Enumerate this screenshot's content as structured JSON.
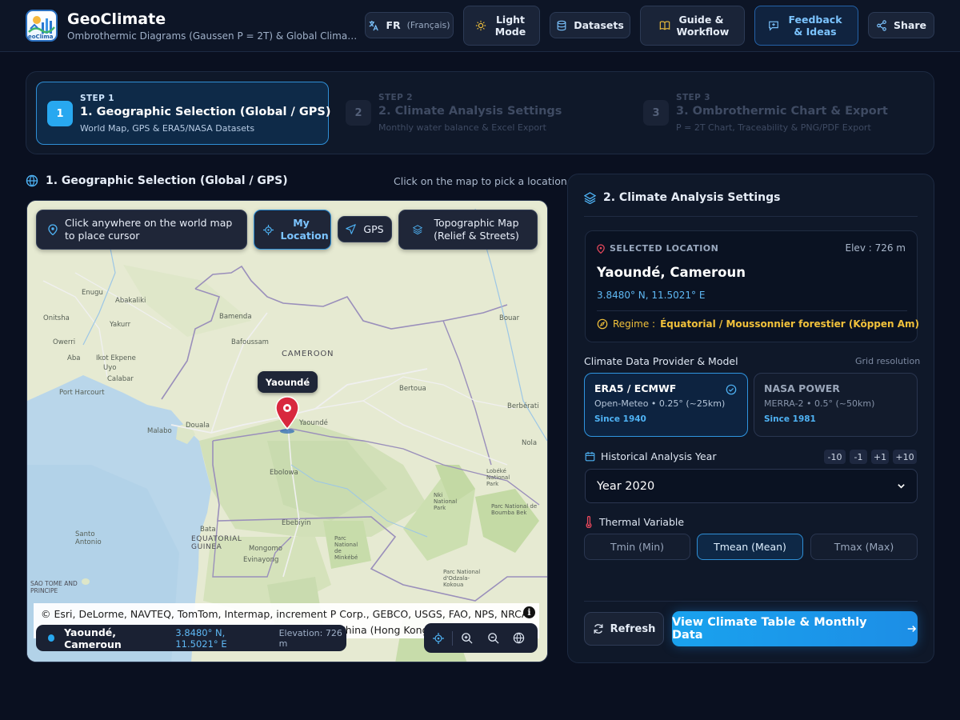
{
  "app": {
    "title": "GeoClimate",
    "subtitle": "Ombrothermic Diagrams (Gaussen P = 2T) & Global Climate Da...",
    "logo_text": "eoClima"
  },
  "header": {
    "lang_code": "FR",
    "lang_name": "(Français)",
    "theme_label": "Light Mode",
    "datasets_label": "Datasets",
    "guide_label": "Guide & Workflow",
    "feedback_label": "Feedback & Ideas",
    "share_label": "Share"
  },
  "steps": [
    {
      "kicker": "STEP 1",
      "number": "1",
      "title": "1. Geographic Selection (Global / GPS)",
      "desc": "World Map, GPS & ERA5/NASA Datasets",
      "active": true
    },
    {
      "kicker": "STEP 2",
      "number": "2",
      "title": "2. Climate Analysis Settings",
      "desc": "Monthly water balance & Excel Export",
      "active": false
    },
    {
      "kicker": "STEP 3",
      "number": "3",
      "title": "3. Ombrothermic Chart & Export",
      "desc": "P = 2T Chart, Traceability & PNG/PDF Export",
      "active": false
    }
  ],
  "geo": {
    "section_title": "1. Geographic Selection (Global / GPS)",
    "hint": "Click on the map to pick a location",
    "click_hint": "Click anywhere on the world map to place cursor",
    "my_location": "My Location",
    "gps": "GPS",
    "map_style": "Topographic Map (Relief & Streets)",
    "pin_label": "Yaoundé",
    "attribution_line1": "© Esri, DeLorme, NAVTEQ, TomTom, Intermap, increment P Corp., GEBCO, USGS, FAO, NPS, NRCAN,",
    "attribution_line2": "China (Hong Kong",
    "place_labels": [
      "Enugu",
      "Abakaliki",
      "Onitsha",
      "Yakurr",
      "Owerri",
      "Aba",
      "Ikot Ekpene",
      "Uyo",
      "Calabar",
      "Port Harcourt",
      "Bamenda",
      "Bafoussam",
      "CAMEROON",
      "Douala",
      "Malabo",
      "Yaoundé",
      "Ebolowa",
      "Ebebiyin",
      "Bata",
      "Mongomo",
      "Evinayong",
      "EQUATORIAL GUINEA",
      "Santo Antonio",
      "SAO TOME AND PRINCIPE",
      "Bertoua",
      "Berbérati",
      "Bouar",
      "Nola",
      "Lobéké National Park",
      "Parc National de Boumba Bek",
      "Nki National Park",
      "Parc National de Minkébé",
      "Parc National d'Odzala-Kokoua"
    ],
    "status_name": "Yaoundé, Cameroun",
    "status_coords": "3.8480° N, 11.5021° E",
    "status_elev": "Elevation: 726 m"
  },
  "settings": {
    "title": "2. Climate Analysis Settings",
    "selected_label": "SELECTED LOCATION",
    "elevation": "Elev : 726 m",
    "place": "Yaoundé, Cameroun",
    "coords": "3.8480° N, 11.5021° E",
    "regime_label": "Regime :",
    "regime_value": "Équatorial / Moussonnier forestier (Köppen Am)",
    "provider_title": "Climate Data Provider & Model",
    "grid_label": "Grid resolution",
    "providers": [
      {
        "name": "ERA5 / ECMWF",
        "detail": "Open-Meteo • 0.25° (~25km)",
        "since": "Since 1940",
        "selected": true
      },
      {
        "name": "NASA POWER",
        "detail": "MERRA-2 • 0.5° (~50km)",
        "since": "Since 1981",
        "selected": false
      }
    ],
    "year_title": "Historical Analysis Year",
    "year_steps": [
      "-10",
      "-1",
      "+1",
      "+10"
    ],
    "year_value": "Year 2020",
    "thermal_title": "Thermal Variable",
    "thermal_options": [
      "Tmin (Min)",
      "Tmean (Mean)",
      "Tmax (Max)"
    ],
    "thermal_selected": "Tmean (Mean)",
    "refresh_label": "Refresh",
    "primary_label": "View Climate Table & Monthly Data"
  },
  "colors": {
    "accent": "#28a8f0",
    "background": "#0a1020",
    "panel": "#0f1829",
    "regime": "#f1c13b",
    "pin": "#d8283e"
  }
}
